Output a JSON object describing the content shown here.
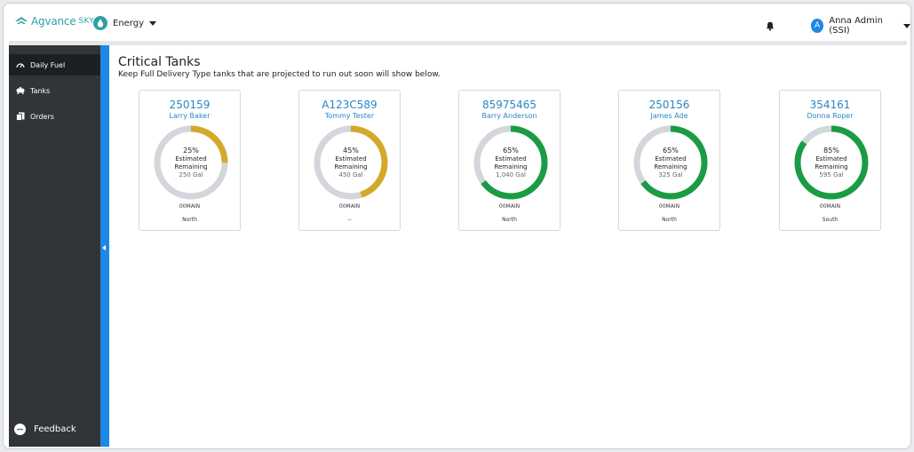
{
  "header": {
    "logo_text": "Agvance",
    "logo_suffix": "SKY",
    "product": "Energy",
    "user_initial": "A",
    "user_name": "Anna Admin (SSI)"
  },
  "sidebar": {
    "items": [
      {
        "label": "Daily Fuel",
        "icon": "gauge-icon",
        "active": true
      },
      {
        "label": "Tanks",
        "icon": "tank-icon",
        "active": false
      },
      {
        "label": "Orders",
        "icon": "orders-icon",
        "active": false
      }
    ],
    "feedback_label": "Feedback"
  },
  "main": {
    "title": "Critical Tanks",
    "subtitle": "Keep Full Delivery Type tanks that are projected to run out soon will show below.",
    "cards": [
      {
        "id": "250159",
        "name": "Larry Baker",
        "percent": 25,
        "pct_label": "25%",
        "line1": "Estimated",
        "line2": "Remaining",
        "gallons": "250 Gal",
        "code": "00MAIN",
        "region": "North",
        "color": "#d4a92a"
      },
      {
        "id": "A123C589",
        "name": "Tommy Tester",
        "percent": 45,
        "pct_label": "45%",
        "line1": "Estimated",
        "line2": "Remaining",
        "gallons": "450 Gal",
        "code": "00MAIN",
        "region": "--",
        "color": "#d4a92a"
      },
      {
        "id": "85975465",
        "name": "Barry Anderson",
        "percent": 65,
        "pct_label": "65%",
        "line1": "Estimated",
        "line2": "Remaining",
        "gallons": "1,040 Gal",
        "code": "00MAIN",
        "region": "North",
        "color": "#1a9c45"
      },
      {
        "id": "250156",
        "name": "James Ade",
        "percent": 65,
        "pct_label": "65%",
        "line1": "Estimated",
        "line2": "Remaining",
        "gallons": "325 Gal",
        "code": "00MAIN",
        "region": "North",
        "color": "#1a9c45"
      },
      {
        "id": "354161",
        "name": "Donna Roper",
        "percent": 85,
        "pct_label": "85%",
        "line1": "Estimated",
        "line2": "Remaining",
        "gallons": "595 Gal",
        "code": "00MAIN",
        "region": "South",
        "color": "#1a9c45"
      }
    ]
  },
  "colors": {
    "track": "#d3d6da",
    "accent": "#1e88e5",
    "link": "#2a86c6",
    "sidebar": "#313538"
  }
}
